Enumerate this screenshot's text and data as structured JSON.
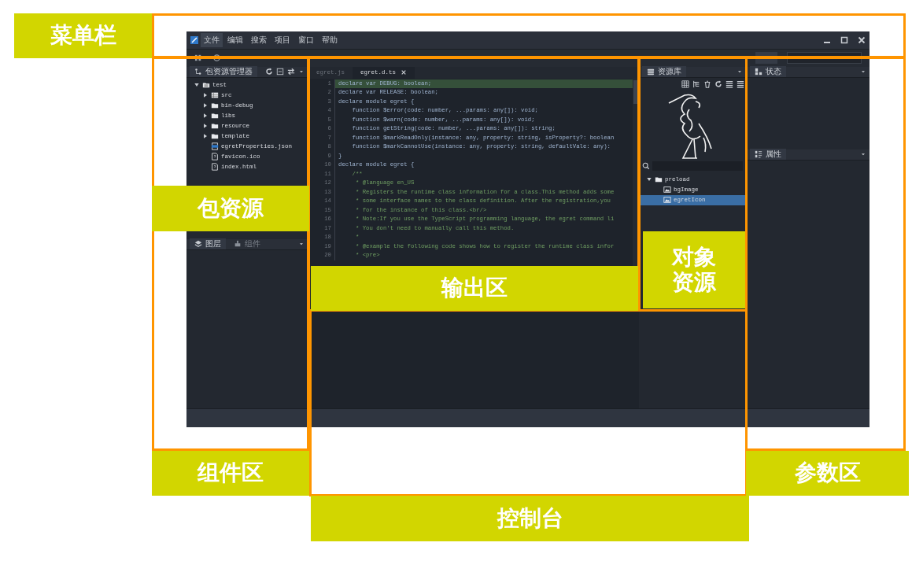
{
  "menu_bar": {
    "items": [
      {
        "label": "文件",
        "selected": true
      },
      {
        "label": "编辑",
        "selected": false
      },
      {
        "label": "搜索",
        "selected": false
      },
      {
        "label": "项目",
        "selected": false
      },
      {
        "label": "窗口",
        "selected": false
      },
      {
        "label": "帮助",
        "selected": false
      }
    ]
  },
  "package_explorer": {
    "title": "包资源管理器",
    "tree": [
      {
        "label": "test",
        "kind": "project",
        "expanded": true,
        "children": [
          {
            "label": "src",
            "kind": "package",
            "expanded": false
          },
          {
            "label": "bin-debug",
            "kind": "folder",
            "expanded": false
          },
          {
            "label": "libs",
            "kind": "folder",
            "expanded": false
          },
          {
            "label": "resource",
            "kind": "folder",
            "expanded": false
          },
          {
            "label": "template",
            "kind": "folder",
            "expanded": false
          },
          {
            "label": "egretProperties.json",
            "kind": "json"
          },
          {
            "label": "favicon.ico",
            "kind": "file"
          },
          {
            "label": "index.html",
            "kind": "file"
          }
        ]
      }
    ]
  },
  "layer_panel": {
    "tabs": [
      {
        "label": "图层",
        "selected": true
      },
      {
        "label": "组件",
        "selected": false
      }
    ]
  },
  "editor": {
    "tabs": [
      {
        "label": "egret.js",
        "selected": false
      },
      {
        "label": "egret.d.ts",
        "selected": true
      }
    ],
    "lines": [
      {
        "number": "1",
        "text": "declare var DEBUG: boolean;",
        "kind": "code",
        "highlighted": true
      },
      {
        "number": "2",
        "text": "declare var RELEASE: boolean;",
        "kind": "code",
        "highlighted": false
      },
      {
        "number": "3",
        "text": "declare module egret {",
        "kind": "code",
        "highlighted": false
      },
      {
        "number": "4",
        "text": "    function $error(code: number, ...params: any[]): void;",
        "kind": "code",
        "highlighted": false
      },
      {
        "number": "5",
        "text": "    function $warn(code: number, ...params: any[]): void;",
        "kind": "code",
        "highlighted": false
      },
      {
        "number": "6",
        "text": "    function getString(code: number, ...params: any[]): string;",
        "kind": "code",
        "highlighted": false
      },
      {
        "number": "7",
        "text": "    function $markReadOnly(instance: any, property: string, isProperty?: boolean",
        "kind": "code",
        "highlighted": false
      },
      {
        "number": "8",
        "text": "    function $markCannotUse(instance: any, property: string, defaultVale: any):",
        "kind": "code",
        "highlighted": false
      },
      {
        "number": "9",
        "text": "}",
        "kind": "code",
        "highlighted": false
      },
      {
        "number": "10",
        "text": "declare module egret {",
        "kind": "code",
        "highlighted": false
      },
      {
        "number": "11",
        "text": "    /**",
        "kind": "comment",
        "highlighted": false
      },
      {
        "number": "12",
        "text": "     * @language en_US",
        "kind": "comment",
        "highlighted": false
      },
      {
        "number": "13",
        "text": "     * Registers the runtime class information for a class.This method adds some",
        "kind": "comment",
        "highlighted": false
      },
      {
        "number": "14",
        "text": "     * some interface names to the class definition. After the registration,you",
        "kind": "comment",
        "highlighted": false
      },
      {
        "number": "15",
        "text": "     * for the instance of this class.<br/>",
        "kind": "comment",
        "highlighted": false
      },
      {
        "number": "16",
        "text": "     * Note:If you use the TypeScript programming language, the egret command li",
        "kind": "comment",
        "highlighted": false
      },
      {
        "number": "17",
        "text": "     * You don't need to manually call this method.",
        "kind": "comment",
        "highlighted": false
      },
      {
        "number": "18",
        "text": "     *",
        "kind": "comment",
        "highlighted": false
      },
      {
        "number": "19",
        "text": "     * @example the following code shows how to register the runtime class infor",
        "kind": "comment",
        "highlighted": false
      },
      {
        "number": "20",
        "text": "     * <pre>",
        "kind": "comment",
        "highlighted": false
      }
    ]
  },
  "resource_library": {
    "title": "资源库",
    "tree": [
      {
        "label": "preload",
        "kind": "folder",
        "expanded": true,
        "selected": false,
        "children": [
          {
            "label": "bgImage",
            "kind": "image",
            "selected": false
          },
          {
            "label": "egretIcon",
            "kind": "image",
            "selected": true
          }
        ]
      }
    ]
  },
  "state_panel": {
    "title": "状态"
  },
  "properties_panel": {
    "title": "属性"
  },
  "annotations": [
    {
      "label": "菜单栏"
    },
    {
      "label": "包资源"
    },
    {
      "label": "输出区"
    },
    {
      "label": "对象资源"
    },
    {
      "label": "组件区"
    },
    {
      "label": "控制台"
    },
    {
      "label": "参数区"
    }
  ]
}
